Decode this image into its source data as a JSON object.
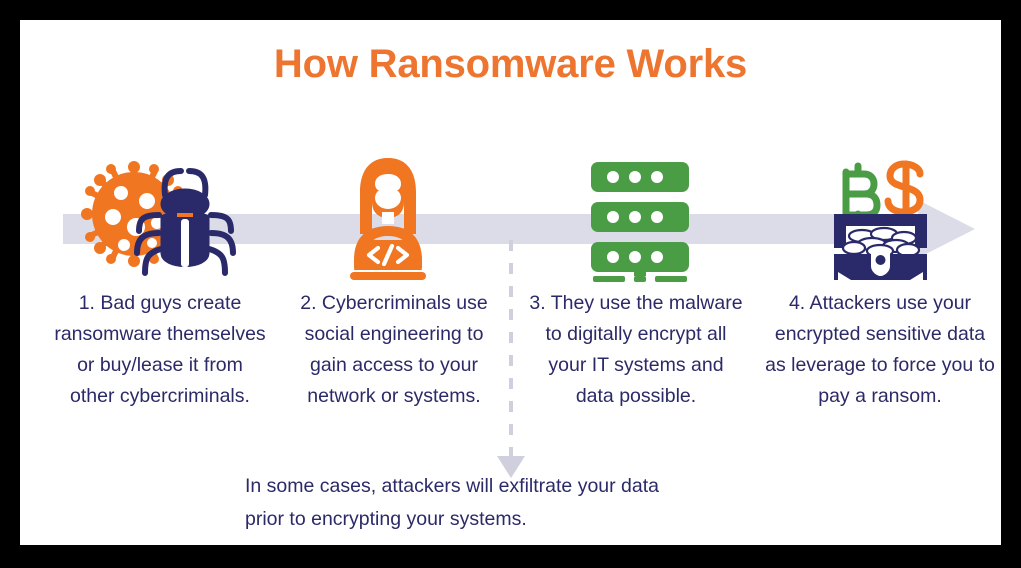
{
  "infographic": {
    "title": "How Ransomware Works",
    "colors": {
      "title_orange": "#ED7530",
      "text_navy": "#2B2A68",
      "band_lavender": "#DCDCE8",
      "icon_orange": "#F07622",
      "icon_navy": "#2A2A6B",
      "icon_green": "#4A9D45"
    },
    "flow_arrow": {
      "direction": "right",
      "label": "process-flow-arrow"
    },
    "steps": [
      {
        "number": "1",
        "icon": "virus-bug-icon",
        "icon_description": "orange virus germ with navy bug",
        "lines": [
          "1. Bad guys create",
          "ransomware themselves",
          "or buy/lease it from",
          "other cybercriminals."
        ]
      },
      {
        "number": "2",
        "icon": "hacker-laptop-icon",
        "icon_description": "orange hacker at laptop with code brackets",
        "lines": [
          "2. Cybercriminals use",
          "social engineering to",
          "gain access to your",
          "network or systems."
        ]
      },
      {
        "number": "3",
        "icon": "server-rack-icon",
        "icon_description": "green three-tier server rack",
        "lines": [
          "3. They use the malware",
          "to digitally encrypt all",
          "your IT systems and",
          "data possible."
        ]
      },
      {
        "number": "4",
        "icon": "treasure-chest-icon",
        "icon_description": "navy treasure chest of coins with bitcoin and dollar symbols",
        "lines": [
          "4. Attackers use your",
          "encrypted sensitive data",
          "as leverage to force you to",
          "pay a ransom."
        ]
      }
    ],
    "branch": {
      "connector": "dashed-down-arrow",
      "lines": [
        "In some cases, attackers will exfiltrate your data",
        "prior to encrypting your systems."
      ]
    }
  }
}
